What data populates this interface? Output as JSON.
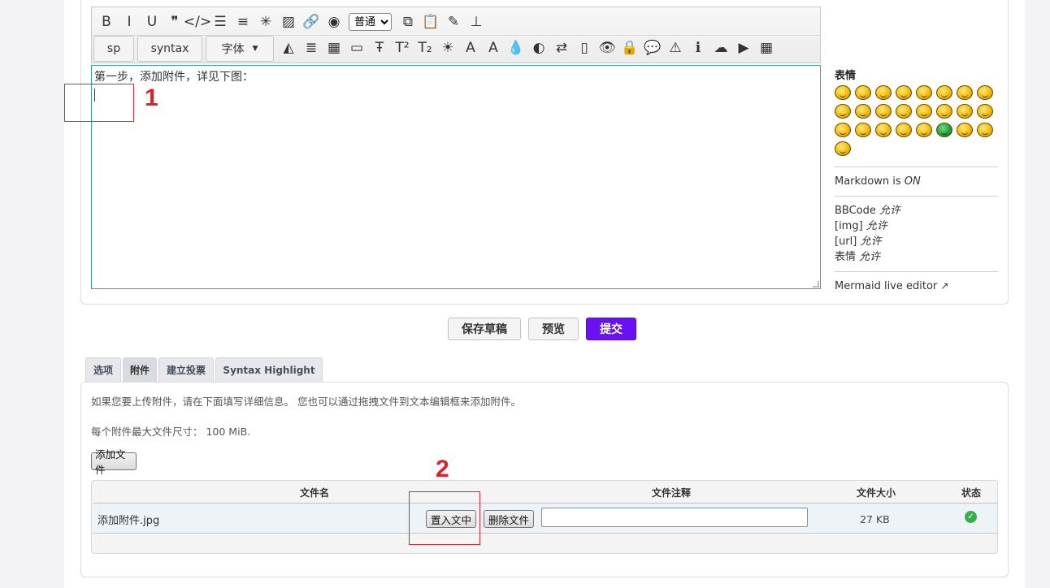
{
  "toolbar": {
    "row1_icons": [
      {
        "name": "bold-icon",
        "glyph": "B"
      },
      {
        "name": "italic-icon",
        "glyph": "I"
      },
      {
        "name": "underline-icon",
        "glyph": "U"
      },
      {
        "name": "quote-icon",
        "glyph": "❞"
      },
      {
        "name": "code-icon",
        "glyph": "</>"
      },
      {
        "name": "bullet-list-icon",
        "glyph": "☰"
      },
      {
        "name": "numbered-list-icon",
        "glyph": "≡"
      },
      {
        "name": "asterisk-icon",
        "glyph": "✳"
      },
      {
        "name": "image-icon",
        "glyph": "▨"
      },
      {
        "name": "link-icon",
        "glyph": "🔗"
      },
      {
        "name": "color-wheel-icon",
        "glyph": "◉"
      }
    ],
    "size_select_value": "普通",
    "row1_icons_after": [
      {
        "name": "copy-icon",
        "glyph": "⧉"
      },
      {
        "name": "paste-icon",
        "glyph": "📋"
      },
      {
        "name": "spellcheck-icon",
        "glyph": "✎"
      },
      {
        "name": "sitemap-icon",
        "glyph": "⊥"
      }
    ],
    "buttons": {
      "sp": "sp",
      "syntax": "syntax",
      "font": "字体"
    },
    "row2_icons": [
      {
        "name": "eraser-icon",
        "glyph": "◭"
      },
      {
        "name": "align-center-icon",
        "glyph": "≣"
      },
      {
        "name": "table-icon",
        "glyph": "▦"
      },
      {
        "name": "frame-icon",
        "glyph": "▭"
      },
      {
        "name": "strikethrough-icon",
        "glyph": "Ŧ"
      },
      {
        "name": "superscript-icon",
        "glyph": "T²"
      },
      {
        "name": "subscript-icon",
        "glyph": "T₂"
      },
      {
        "name": "sun-icon",
        "glyph": "☀"
      },
      {
        "name": "shadow-text-icon",
        "glyph": "A"
      },
      {
        "name": "outline-text-icon",
        "glyph": "A"
      },
      {
        "name": "drop-icon",
        "glyph": "💧"
      },
      {
        "name": "contrast-drop-icon",
        "glyph": "◐"
      },
      {
        "name": "swap-icon",
        "glyph": "⇄"
      },
      {
        "name": "box-icon",
        "glyph": "▯"
      },
      {
        "name": "hide-icon",
        "glyph": "👁"
      },
      {
        "name": "lock-icon",
        "glyph": "🔒"
      },
      {
        "name": "speech-bubble-icon",
        "glyph": "💬"
      },
      {
        "name": "warning-icon",
        "glyph": "⚠"
      },
      {
        "name": "info-icon",
        "glyph": "ℹ"
      },
      {
        "name": "soundcloud-icon",
        "glyph": "☁"
      },
      {
        "name": "video-icon",
        "glyph": "▶"
      },
      {
        "name": "grid-icon",
        "glyph": "▦"
      }
    ]
  },
  "editor": {
    "text": "第一步，添加附件，详见下图："
  },
  "annotations": {
    "marker1": "1",
    "marker2": "2"
  },
  "sidebar": {
    "smilies_title": "表情",
    "smilies_count": 25,
    "markdown_label": "Markdown is ",
    "markdown_state": "ON",
    "perms": [
      {
        "label": "BBCode ",
        "value": "允许"
      },
      {
        "label": "[img] ",
        "value": "允许"
      },
      {
        "label": "[url] ",
        "value": "允许"
      },
      {
        "label": "表情 ",
        "value": "允许"
      }
    ],
    "mermaid_link": "Mermaid live editor"
  },
  "actions": {
    "save_draft": "保存草稿",
    "preview": "预览",
    "submit": "提交"
  },
  "tabs": [
    {
      "label": "选项"
    },
    {
      "label": "附件"
    },
    {
      "label": "建立投票"
    },
    {
      "label": "Syntax Highlight"
    }
  ],
  "attachments": {
    "help_text": "如果您要上传附件，请在下面填写详细信息。 您也可以通过拖拽文件到文本编辑框来添加附件。",
    "max_size_text": "每个附件最大文件尺寸： 100 MiB.",
    "add_file_button": "添加文件",
    "columns": {
      "filename": "文件名",
      "comment": "文件注释",
      "size": "文件大小",
      "status": "状态"
    },
    "rows": [
      {
        "filename": "添加附件.jpg",
        "insert_button": "置入文中",
        "delete_button": "删除文件",
        "comment": "",
        "size": "27 KB",
        "status_icon": "check-circle-icon"
      }
    ]
  },
  "colors": {
    "accent": "#6a11f2",
    "editor_border": "#3ba4a8",
    "annotation_red": "#d9232e",
    "status_ok": "#35b04a"
  }
}
